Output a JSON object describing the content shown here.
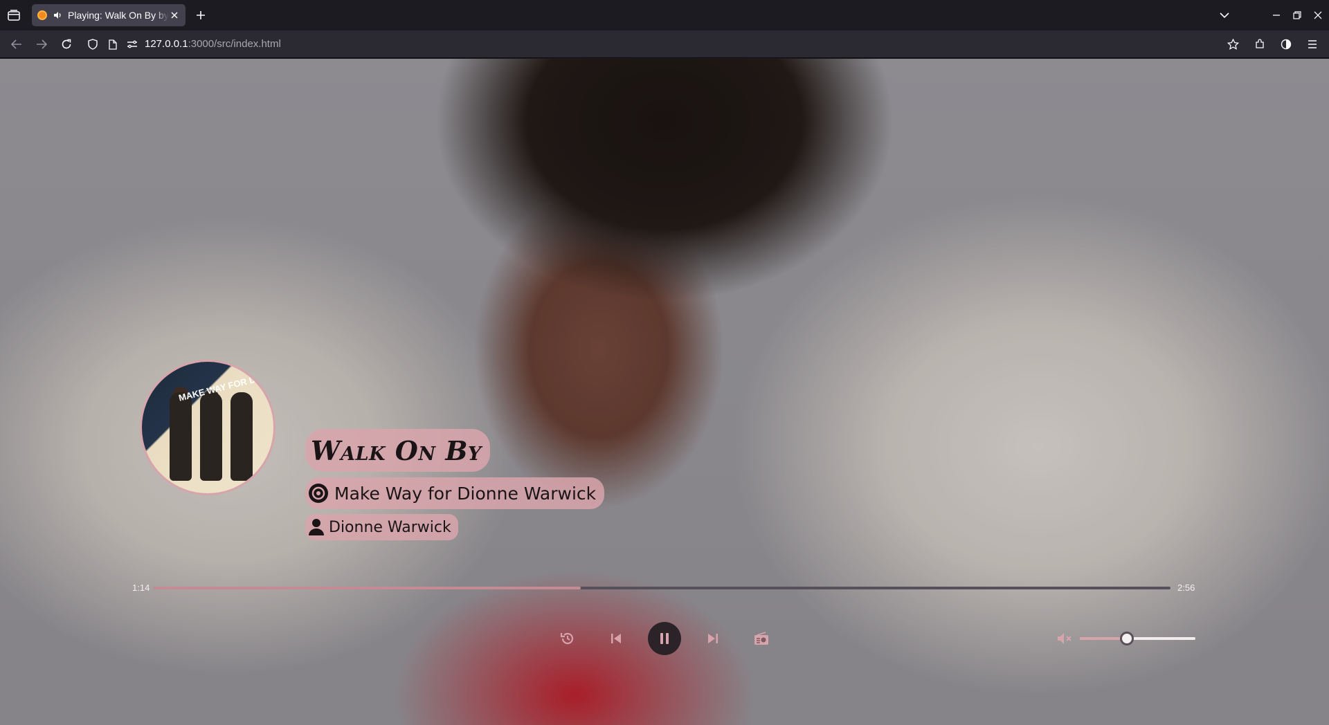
{
  "browser": {
    "tab_title": "Playing: Walk On By by Dionne Warwick",
    "url_host": "127.0.0.1",
    "url_rest": ":3000/src/index.html"
  },
  "colors": {
    "accent": "#d8a4ac",
    "progress_fill": "#c48b95",
    "favicon": "#f08a1c"
  },
  "icons": [
    "tabs-list-icon",
    "audio-icon",
    "close-icon",
    "plus-icon",
    "chevron-down-icon",
    "minimize-icon",
    "restore-icon",
    "close-window-icon",
    "back-icon",
    "forward-icon",
    "reload-icon",
    "shield-icon",
    "page-icon",
    "permissions-icon",
    "star-icon",
    "extensions-icon",
    "account-icon",
    "menu-icon",
    "album-icon",
    "artist-icon",
    "replay-icon",
    "previous-icon",
    "pause-icon",
    "next-icon",
    "radio-icon",
    "volume-icon"
  ],
  "player": {
    "track_title": "Walk On By",
    "album": "Make Way for Dionne Warwick",
    "artist": "Dionne Warwick",
    "cover_text": "MAKE WAY FOR DIONNE WARWICK",
    "elapsed": "1:14",
    "duration": "2:56",
    "progress": 0.42,
    "volume": 0.41,
    "muted": true,
    "is_playing": true
  }
}
